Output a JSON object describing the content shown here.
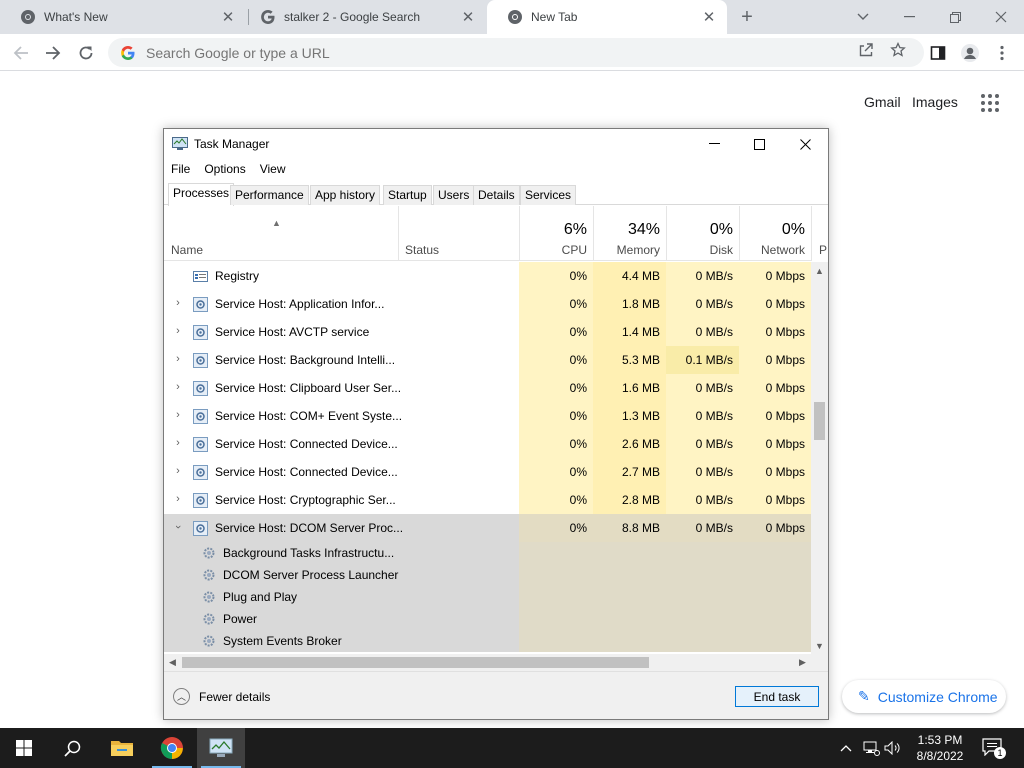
{
  "browser": {
    "tabs": [
      {
        "title": "What's New",
        "active": false
      },
      {
        "title": "stalker 2 - Google Search",
        "active": false
      },
      {
        "title": "New Tab",
        "active": true
      }
    ],
    "omnibox_placeholder": "Search Google or type a URL"
  },
  "ntp": {
    "gmail": "Gmail",
    "images": "Images",
    "customize": "Customize Chrome"
  },
  "task_manager": {
    "title": "Task Manager",
    "menu": [
      "File",
      "Options",
      "View"
    ],
    "tabs": [
      "Processes",
      "Performance",
      "App history",
      "Startup",
      "Users",
      "Details",
      "Services"
    ],
    "selected_tab": "Processes",
    "columns": {
      "name": "Name",
      "status": "Status",
      "cpu": {
        "pct": "6%",
        "label": "CPU"
      },
      "memory": {
        "pct": "34%",
        "label": "Memory"
      },
      "disk": {
        "pct": "0%",
        "label": "Disk"
      },
      "network": {
        "pct": "0%",
        "label": "Network"
      },
      "power_cut": "P"
    },
    "processes": [
      {
        "name": "Registry",
        "cpu": "0%",
        "memory": "4.4 MB",
        "disk": "0 MB/s",
        "network": "0 Mbps",
        "expandable": false
      },
      {
        "name": "Service Host: Application Infor...",
        "cpu": "0%",
        "memory": "1.8 MB",
        "disk": "0 MB/s",
        "network": "0 Mbps",
        "expandable": true
      },
      {
        "name": "Service Host: AVCTP service",
        "cpu": "0%",
        "memory": "1.4 MB",
        "disk": "0 MB/s",
        "network": "0 Mbps",
        "expandable": true
      },
      {
        "name": "Service Host: Background Intelli...",
        "cpu": "0%",
        "memory": "5.3 MB",
        "disk": "0.1 MB/s",
        "network": "0 Mbps",
        "expandable": true
      },
      {
        "name": "Service Host: Clipboard User Ser...",
        "cpu": "0%",
        "memory": "1.6 MB",
        "disk": "0 MB/s",
        "network": "0 Mbps",
        "expandable": true
      },
      {
        "name": "Service Host: COM+ Event Syste...",
        "cpu": "0%",
        "memory": "1.3 MB",
        "disk": "0 MB/s",
        "network": "0 Mbps",
        "expandable": true
      },
      {
        "name": "Service Host: Connected Device...",
        "cpu": "0%",
        "memory": "2.6 MB",
        "disk": "0 MB/s",
        "network": "0 Mbps",
        "expandable": true
      },
      {
        "name": "Service Host: Connected Device...",
        "cpu": "0%",
        "memory": "2.7 MB",
        "disk": "0 MB/s",
        "network": "0 Mbps",
        "expandable": true
      },
      {
        "name": "Service Host: Cryptographic Ser...",
        "cpu": "0%",
        "memory": "2.8 MB",
        "disk": "0 MB/s",
        "network": "0 Mbps",
        "expandable": true
      }
    ],
    "expanded_group": {
      "name": "Service Host: DCOM Server Proc...",
      "cpu": "0%",
      "memory": "8.8 MB",
      "disk": "0 MB/s",
      "network": "0 Mbps",
      "children": [
        "Background Tasks Infrastructu...",
        "DCOM Server Process Launcher",
        "Plug and Play",
        "Power",
        "System Events Broker"
      ]
    },
    "fewer_details": "Fewer details",
    "end_task": "End task"
  },
  "taskbar": {
    "time": "1:53 PM",
    "date": "8/8/2022",
    "notification_count": "1"
  },
  "colors": {
    "chrome_frame": "#dee1e6",
    "accent_blue": "#1a73e8",
    "heat_light": "#fff4c4",
    "heat_mid": "#f9eca8",
    "selection_gray": "#d9d9d9",
    "taskbar": "#1c1c1c"
  }
}
